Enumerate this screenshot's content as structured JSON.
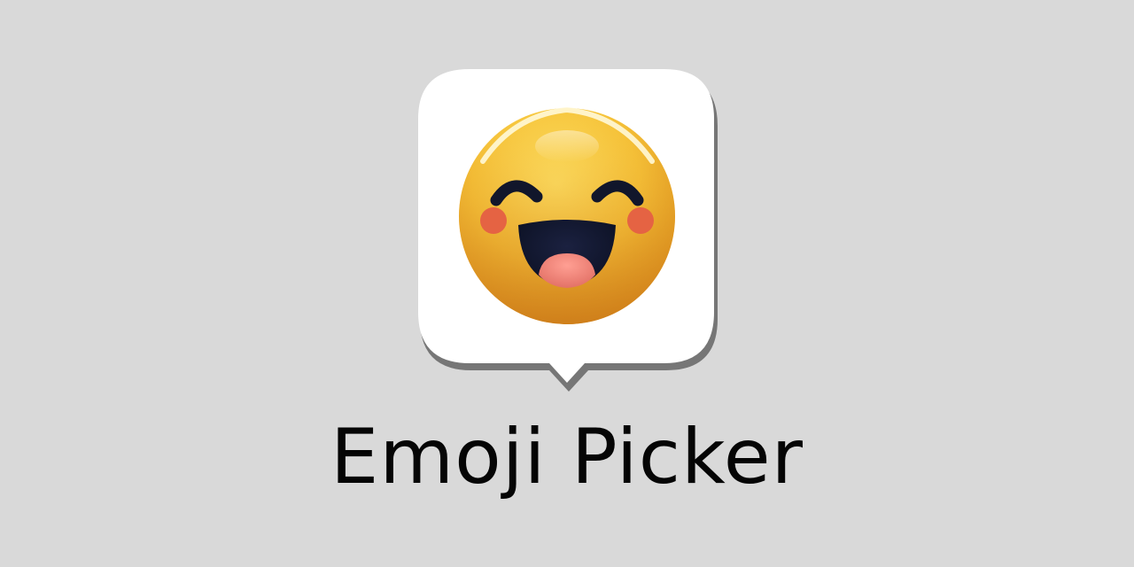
{
  "app": {
    "title": "Emoji Picker",
    "icon": "grinning-smiling-eyes-emoji-icon"
  },
  "colors": {
    "background": "#d9d9d9",
    "card": "#ffffff",
    "face_yellow": "#f6c43a",
    "face_shade": "#e39a20",
    "cheeks": "#e56343",
    "eyes_mouth": "#11162b",
    "tongue": "#f07d73"
  }
}
